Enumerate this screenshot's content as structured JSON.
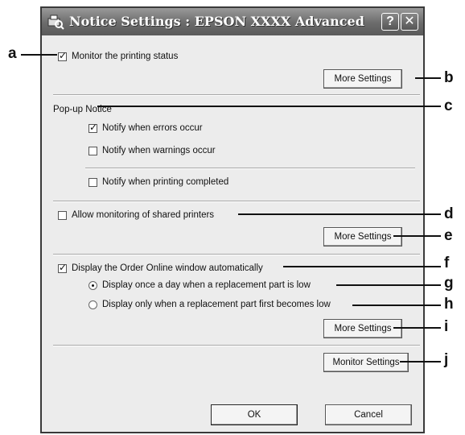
{
  "window": {
    "title": "Notice Settings : EPSON XXXX Advanced",
    "help_glyph": "?",
    "close_glyph": "✕",
    "icon": "printer-search-icon"
  },
  "monitor": {
    "label": "Monitor the printing status",
    "checked": true,
    "more_settings_label": "More Settings"
  },
  "popup": {
    "heading": "Pop-up Notice",
    "items": [
      {
        "label": "Notify when errors occur",
        "checked": true
      },
      {
        "label": "Notify when warnings occur",
        "checked": false
      },
      {
        "label": "Notify when printing completed",
        "checked": false
      }
    ]
  },
  "shared": {
    "label": "Allow monitoring of shared printers",
    "checked": false,
    "more_settings_label": "More Settings"
  },
  "order": {
    "label": "Display the Order Online window automatically",
    "checked": true,
    "options": [
      {
        "label": "Display once a day when a replacement part is low",
        "selected": true
      },
      {
        "label": "Display only when a replacement part first becomes low",
        "selected": false
      }
    ],
    "more_settings_label": "More Settings"
  },
  "monitor_settings_label": "Monitor Settings",
  "ok_label": "OK",
  "cancel_label": "Cancel",
  "callouts": [
    "a",
    "b",
    "c",
    "d",
    "e",
    "f",
    "g",
    "h",
    "i",
    "j"
  ]
}
